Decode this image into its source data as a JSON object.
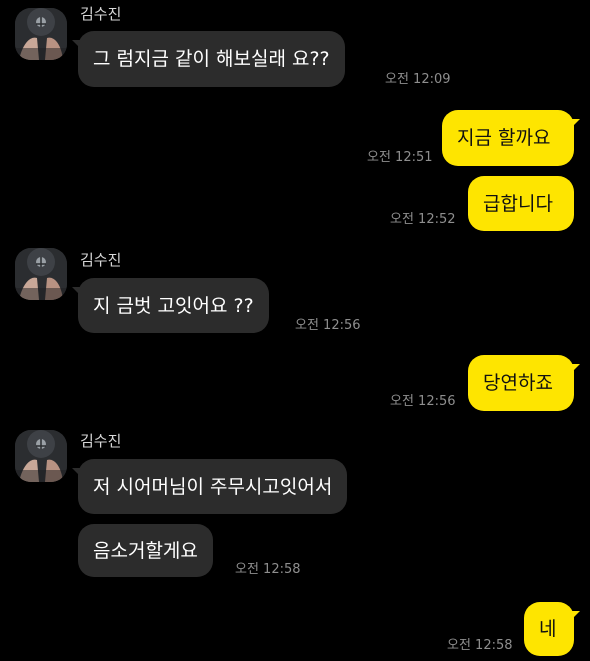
{
  "sender": {
    "name": "김수진"
  },
  "messages": [
    {
      "from": "them",
      "text": "그 럼지금  같이 해보실래 요??",
      "time": "오전 12:09"
    },
    {
      "from": "me",
      "text": "지금 할까요",
      "time": "오전 12:51"
    },
    {
      "from": "me",
      "text": "급합니다",
      "time": "오전 12:52"
    },
    {
      "from": "them",
      "text": "지 금벗 고잇어요 ??",
      "time": "오전 12:56"
    },
    {
      "from": "me",
      "text": "당연하죠",
      "time": "오전 12:56"
    },
    {
      "from": "them",
      "text": "저 시어머님이 주무시고잇어서",
      "time": ""
    },
    {
      "from": "them",
      "text": "음소거할게요",
      "time": "오전 12:58"
    },
    {
      "from": "me",
      "text": "네",
      "time": "오전 12:58"
    }
  ],
  "colors": {
    "background": "#000000",
    "incoming_bubble": "#2c2c2c",
    "outgoing_bubble": "#fee500",
    "timestamp": "#8e8e8e"
  },
  "icons": {
    "avatar": "profile-photo"
  }
}
